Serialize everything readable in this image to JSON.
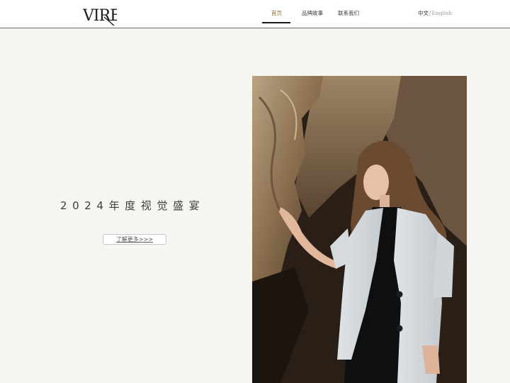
{
  "header": {
    "logo_text": "VIRE",
    "nav": [
      {
        "label": "首页",
        "active": true
      },
      {
        "label": "品牌故事",
        "active": false
      },
      {
        "label": "联系我们",
        "active": false
      }
    ],
    "lang": {
      "zh": "中文",
      "separator": "/",
      "en": "English"
    }
  },
  "hero": {
    "title": "2024年度视觉盛宴",
    "more_button": "了解更多>>>"
  },
  "colors": {
    "background": "#f7f5f1",
    "active_nav": "#8a6d3b",
    "text_dark": "#3d3d3d"
  }
}
